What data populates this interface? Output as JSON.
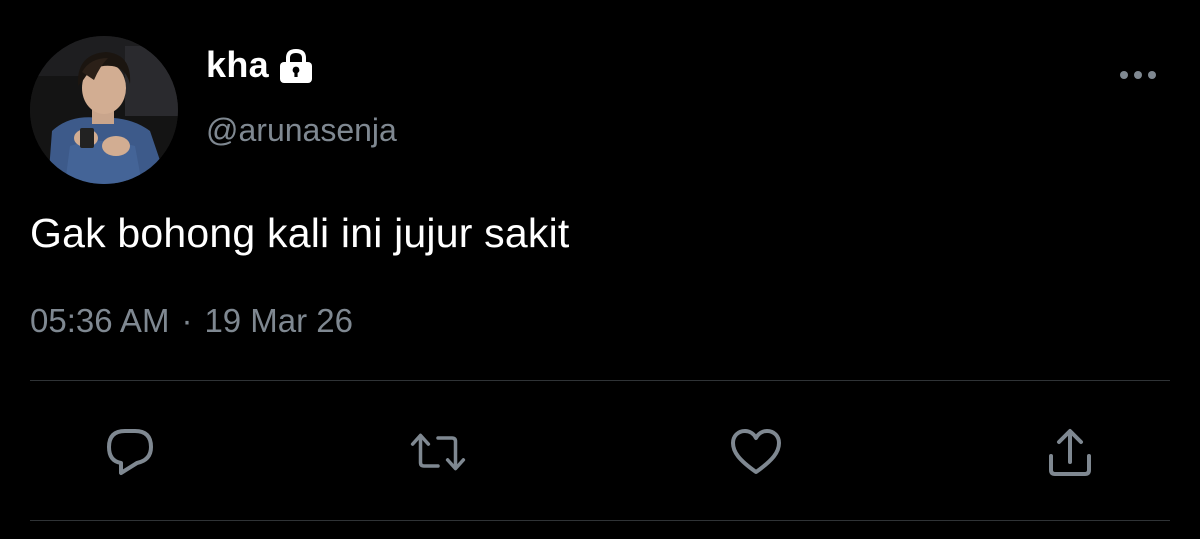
{
  "user": {
    "display_name": "kha",
    "handle": "@arunasenja",
    "protected_icon": "lock-icon",
    "avatar": "profile-photo"
  },
  "tweet": {
    "text": "Gak bohong kali ini jujur sakit",
    "time": "05:36 AM",
    "separator": "·",
    "date": "19 Mar 26"
  },
  "actions": [
    {
      "name": "reply",
      "icon": "reply-icon"
    },
    {
      "name": "retweet",
      "icon": "retweet-icon"
    },
    {
      "name": "like",
      "icon": "heart-icon"
    },
    {
      "name": "share",
      "icon": "share-icon"
    }
  ],
  "more_menu_icon": "more-options-icon",
  "colors": {
    "background": "#000000",
    "text_primary": "#ffffff",
    "text_secondary": "#7f8891",
    "divider": "#2f3336",
    "icon": "#7f8891"
  }
}
